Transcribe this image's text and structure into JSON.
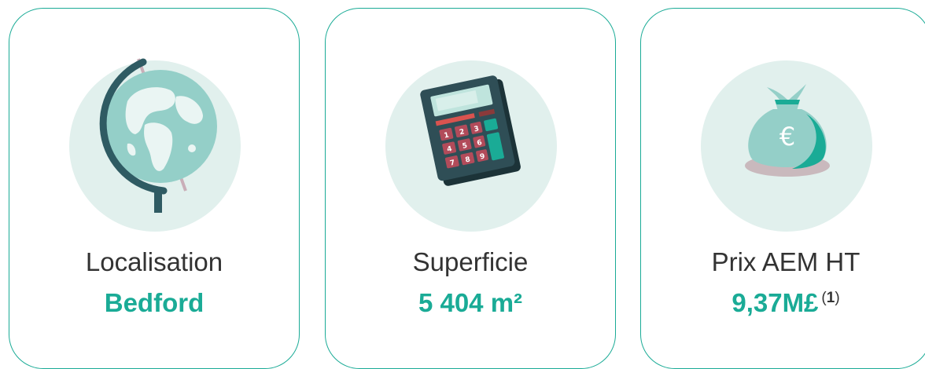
{
  "cards": [
    {
      "label": "Localisation",
      "value": "Bedford",
      "icon": "globe-icon"
    },
    {
      "label": "Superficie",
      "value": "5 404 m²",
      "icon": "calculator-icon",
      "keys": [
        "1",
        "2",
        "3",
        "4",
        "5",
        "6",
        "7",
        "8",
        "9"
      ]
    },
    {
      "label": "Prix AEM HT",
      "value": "9,37M£",
      "icon": "money-bag-icon",
      "symbol": "€",
      "note_open": "(",
      "note_num": "1",
      "note_close": ")"
    }
  ],
  "colors": {
    "accent": "#1aab96",
    "circle_bg": "#e1f0ed",
    "text": "#333333"
  }
}
